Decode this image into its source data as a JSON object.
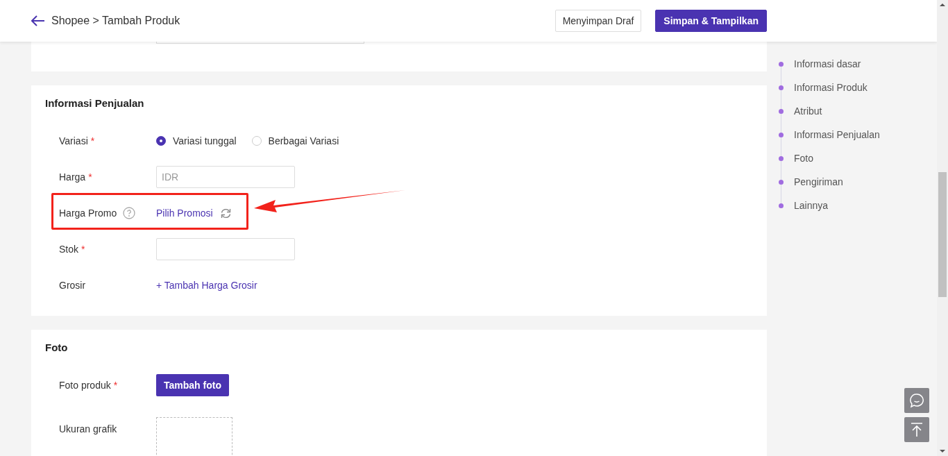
{
  "header": {
    "breadcrumb": "Shopee > Tambah Produk",
    "buttons": [
      {
        "label": "Menyimpan Draf",
        "kind": "secondary"
      },
      {
        "label": "Simpan & Tampilkan",
        "kind": "primary"
      }
    ]
  },
  "sections": [
    {
      "title": "Informasi Penjualan",
      "rows": [
        {
          "kind": "radio",
          "label": "Variasi",
          "mark": "*",
          "options": [
            {
              "label": "Variasi tunggal",
              "selected": true
            },
            {
              "label": "Berbagai Variasi",
              "selected": false
            }
          ]
        },
        {
          "kind": "input",
          "label": "Harga",
          "mark": "*",
          "placeholder": "IDR"
        },
        {
          "kind": "promo",
          "label": "Harga Promo",
          "link": "Pilih Promosi",
          "highlighted": true
        },
        {
          "kind": "input",
          "label": "Stok",
          "mark": "*"
        },
        {
          "kind": "link",
          "label": "Grosir",
          "link": "+ Tambah Harga Grosir"
        }
      ]
    },
    {
      "title": "Foto",
      "rows": [
        {
          "kind": "button",
          "label": "Foto produk",
          "mark": "*",
          "button": "Tambah foto"
        },
        {
          "kind": "dropzone",
          "label": "Ukuran grafik"
        }
      ]
    }
  ],
  "nav": {
    "items": [
      "Informasi dasar",
      "Informasi Produk",
      "Atribut",
      "Informasi Penjualan",
      "Foto",
      "Pengiriman",
      "Lainnya"
    ]
  }
}
